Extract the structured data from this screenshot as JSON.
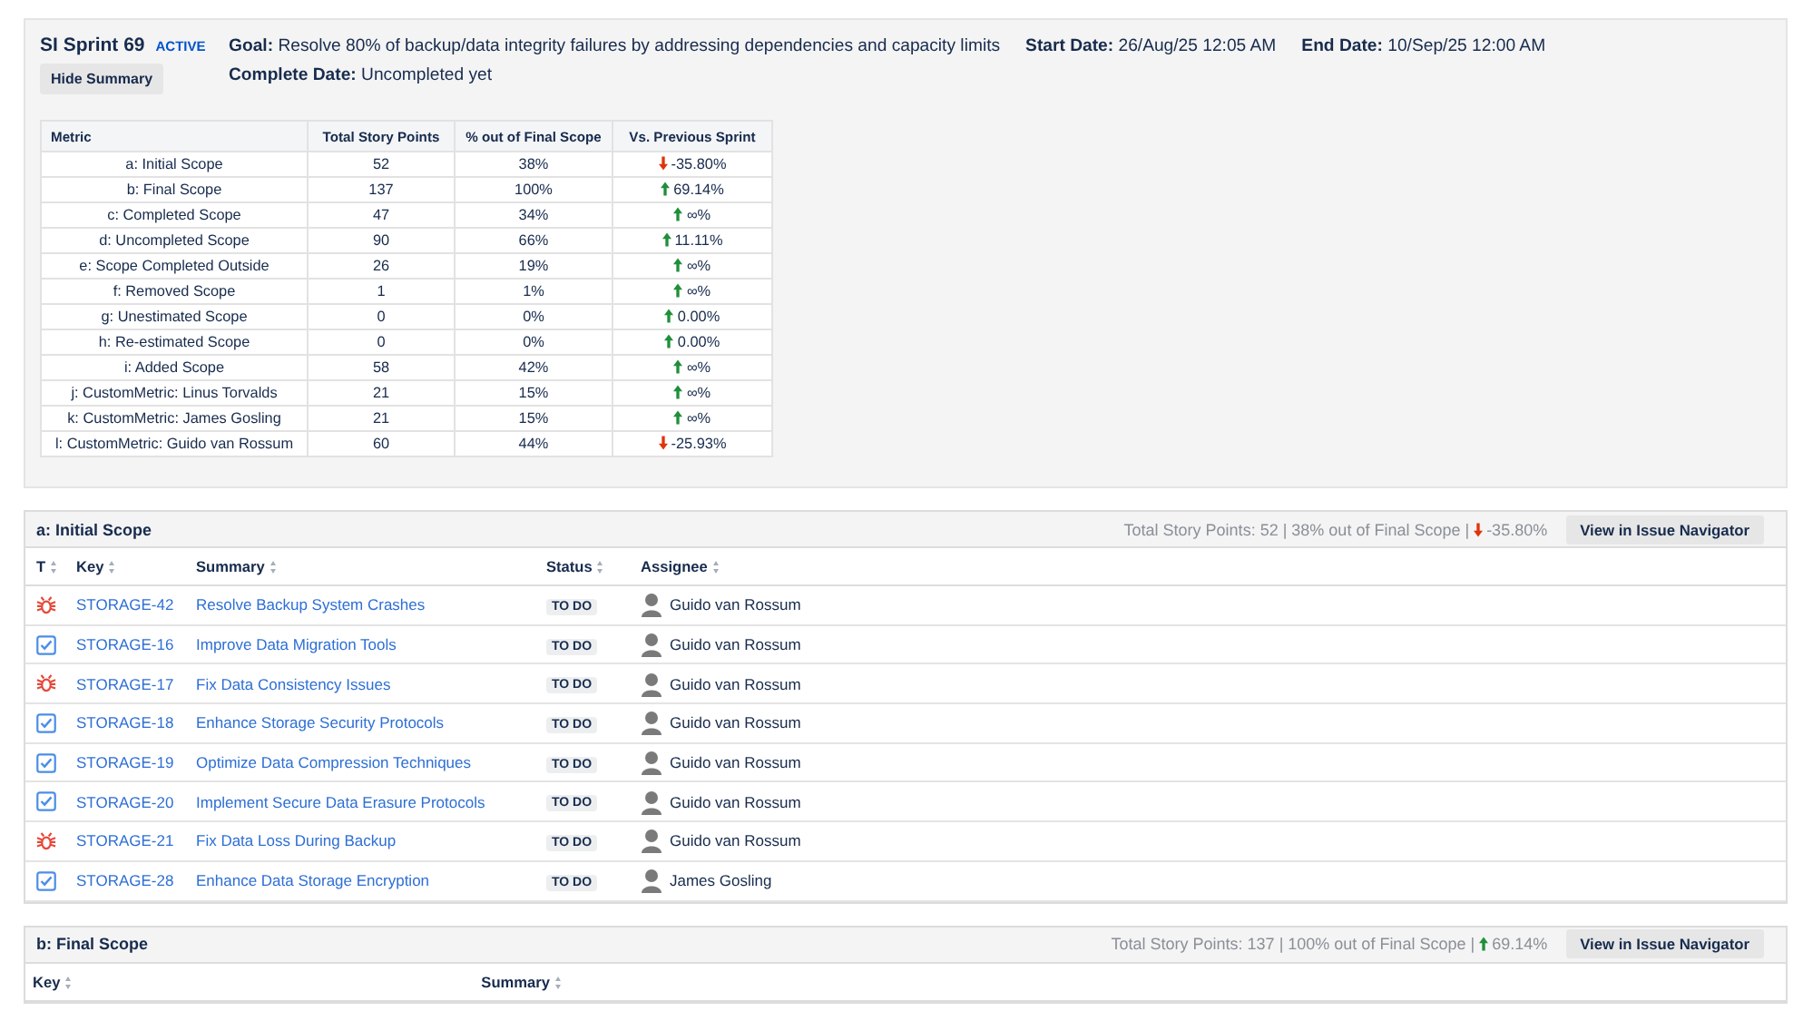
{
  "sprint": {
    "name": "SI Sprint 69",
    "status": "ACTIVE",
    "hide_button": "Hide Summary",
    "goal": "**Goal:** Resolve 80% of backup/data integrity failures by addressing dependencies and capacity limits",
    "start": "**Start Date:** 26/Aug/25 12:05 AM",
    "end": "**End Date:** 10/Sep/25 12:00 AM",
    "complete": "**Complete Date:** Uncompleted yet"
  },
  "metrics": {
    "columns": [
      "Metric",
      "Total Story Points",
      "% out of Final Scope",
      "Vs. Previous Sprint"
    ],
    "rows": [
      {
        "metric": "a: Initial Scope",
        "points": "52",
        "percent": "38%",
        "change": {
          "kind": "down",
          "value": "-35.80%"
        }
      },
      {
        "metric": "b: Final Scope",
        "points": "137",
        "percent": "100%",
        "change": {
          "kind": "up",
          "value": "69.14%"
        }
      },
      {
        "metric": "c: Completed Scope",
        "points": "47",
        "percent": "34%",
        "change": {
          "kind": "up",
          "value": "∞%"
        }
      },
      {
        "metric": "d: Uncompleted Scope",
        "points": "90",
        "percent": "66%",
        "change": {
          "kind": "up",
          "value": "11.11%"
        }
      },
      {
        "metric": "e: Scope Completed Outside",
        "points": "26",
        "percent": "19%",
        "change": {
          "kind": "up",
          "value": "∞%"
        }
      },
      {
        "metric": "f: Removed Scope",
        "points": "1",
        "percent": "1%",
        "change": {
          "kind": "up",
          "value": "∞%"
        }
      },
      {
        "metric": "g: Unestimated Scope",
        "points": "0",
        "percent": "0%",
        "change": {
          "kind": "up",
          "value": "0.00%"
        }
      },
      {
        "metric": "h: Re-estimated Scope",
        "points": "0",
        "percent": "0%",
        "change": {
          "kind": "up",
          "value": "0.00%"
        }
      },
      {
        "metric": "i: Added Scope",
        "points": "58",
        "percent": "42%",
        "change": {
          "kind": "up",
          "value": "∞%"
        }
      },
      {
        "metric": "j: CustomMetric: Linus Torvalds",
        "points": "21",
        "percent": "15%",
        "change": {
          "kind": "up",
          "value": "∞%"
        }
      },
      {
        "metric": "k: CustomMetric: James Gosling",
        "points": "21",
        "percent": "15%",
        "change": {
          "kind": "up",
          "value": "∞%"
        }
      },
      {
        "metric": "l: CustomMetric: Guido van Rossum",
        "points": "60",
        "percent": "44%",
        "change": {
          "kind": "down",
          "value": "-25.93%"
        }
      }
    ]
  },
  "scopes": [
    {
      "title": "a: Initial Scope",
      "totals": "Total Story Points: 52 | 38% out of Final Scope |",
      "change": {
        "kind": "down",
        "value": "-35.80%"
      },
      "button": "View in Issue Navigator",
      "columns": [
        {
          "kind": "type",
          "label": "T"
        },
        {
          "kind": "key",
          "label": "Key"
        },
        {
          "kind": "summary",
          "label": "Summary"
        },
        {
          "kind": "status",
          "label": "Status"
        },
        {
          "kind": "assignee",
          "label": "Assignee"
        }
      ],
      "rows": [
        {
          "kind": "bug",
          "key": "STORAGE-42",
          "summary": "Resolve Backup System Crashes",
          "status": "TO DO",
          "assignee": "Guido van Rossum"
        },
        {
          "kind": "task",
          "key": "STORAGE-16",
          "summary": "Improve Data Migration Tools",
          "status": "TO DO",
          "assignee": "Guido van Rossum"
        },
        {
          "kind": "bug",
          "key": "STORAGE-17",
          "summary": "Fix Data Consistency Issues",
          "status": "TO DO",
          "assignee": "Guido van Rossum"
        },
        {
          "kind": "task",
          "key": "STORAGE-18",
          "summary": "Enhance Storage Security Protocols",
          "status": "TO DO",
          "assignee": "Guido van Rossum"
        },
        {
          "kind": "task",
          "key": "STORAGE-19",
          "summary": "Optimize Data Compression Techniques",
          "status": "TO DO",
          "assignee": "Guido van Rossum"
        },
        {
          "kind": "task",
          "key": "STORAGE-20",
          "summary": "Implement Secure Data Erasure Protocols",
          "status": "TO DO",
          "assignee": "Guido van Rossum"
        },
        {
          "kind": "bug",
          "key": "STORAGE-21",
          "summary": "Fix Data Loss During Backup",
          "status": "TO DO",
          "assignee": "Guido van Rossum"
        },
        {
          "kind": "task",
          "key": "STORAGE-28",
          "summary": "Enhance Data Storage Encryption",
          "status": "TO DO",
          "assignee": "James Gosling"
        }
      ]
    },
    {
      "title": "b: Final Scope",
      "totals": "Total Story Points: 137 | 100% out of Final Scope |",
      "change": {
        "kind": "up",
        "value": "69.14%"
      },
      "button": "View in Issue Navigator",
      "columns": [
        {
          "kind": "key",
          "label": "Key"
        },
        {
          "kind": "summary",
          "label": "Summary"
        }
      ]
    }
  ]
}
